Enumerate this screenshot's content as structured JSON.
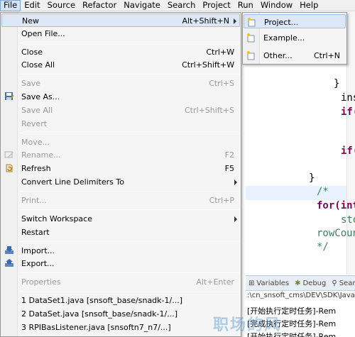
{
  "menubar": {
    "items": [
      "File",
      "Edit",
      "Source",
      "Refactor",
      "Navigate",
      "Search",
      "Project",
      "Run",
      "Window",
      "Help"
    ]
  },
  "file_menu": {
    "new": {
      "label": "New",
      "accel": "Alt+Shift+N"
    },
    "open_file": {
      "label": "Open File..."
    },
    "close": {
      "label": "Close",
      "accel": "Ctrl+W"
    },
    "close_all": {
      "label": "Close All",
      "accel": "Ctrl+Shift+W"
    },
    "save": {
      "label": "Save",
      "accel": "Ctrl+S"
    },
    "save_as": {
      "label": "Save As..."
    },
    "save_all": {
      "label": "Save All",
      "accel": "Ctrl+Shift+S"
    },
    "revert": {
      "label": "Revert"
    },
    "move": {
      "label": "Move..."
    },
    "rename": {
      "label": "Rename...",
      "accel": "F2"
    },
    "refresh": {
      "label": "Refresh",
      "accel": "F5"
    },
    "convert": {
      "label": "Convert Line Delimiters To"
    },
    "print": {
      "label": "Print...",
      "accel": "Ctrl+P"
    },
    "switch_workspace": {
      "label": "Switch Workspace"
    },
    "restart": {
      "label": "Restart"
    },
    "import": {
      "label": "Import..."
    },
    "export": {
      "label": "Export..."
    },
    "properties": {
      "label": "Properties",
      "accel": "Alt+Enter"
    },
    "recent": [
      "1 DataSet1.java  [snsoft_base/snadk-1/...]",
      "2 DataSet.java  [snsoft_base/snadk-1/...]",
      "3 RPIBasListener.java  [snsoftn7_n7/...]"
    ]
  },
  "new_submenu": {
    "project": {
      "label": "Project..."
    },
    "example": {
      "label": "Example..."
    },
    "other": {
      "label": "Other...",
      "accel": "Ctrl+N"
    }
  },
  "editor": {
    "lines": {
      "brace1": "}",
      "ins": "ins",
      "if1": "if(",
      "if2": "if(",
      "brace2": "}",
      "comment_open": "/*",
      "for": "for(int",
      "sto": "sto",
      "rowcount": "rowCount",
      "comment_close": "*/"
    }
  },
  "panel": {
    "tabs": [
      "Variables",
      "Debug",
      "Search"
    ],
    "path": ":\\cn_snsoft_cms\\DEV\\SDK\\Java",
    "console": [
      "[开始执行定时任务]-Rem",
      "[完成执行定时任务]-Rem",
      "[开始执行定时任务]-Rem"
    ]
  },
  "watermark": "职场的风"
}
